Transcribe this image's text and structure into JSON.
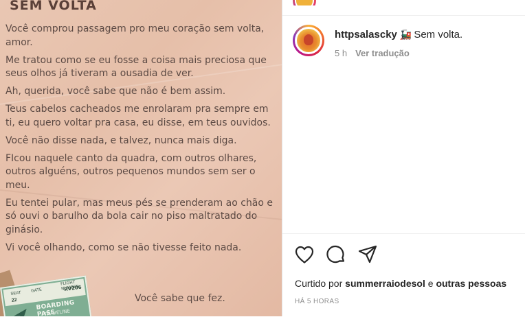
{
  "poem": {
    "title": "SEM VOLTA",
    "stanzas": [
      "Você comprou passagem pro meu coração sem volta, amor.",
      "Me tratou como se eu fosse a coisa mais preciosa que seus olhos já tiveram a ousadia de ver.",
      "Ah, querida, você sabe que não é bem assim.",
      "Teus cabelos cacheados me enrolaram pra sempre em ti, eu quero voltar pra casa, eu disse, em teus ouvidos.",
      "Você não disse nada, e talvez, nunca mais diga.",
      "FIcou naquele canto da quadra, com outros olhares, outros alguéns, outros pequenos mundos sem ser o meu.",
      "Eu tentei pular, mas meus pés se prenderam ao chão e só ouvi o barulho da bola cair no piso maltratado do ginásio.",
      "Vi você olhando, como se não tivesse feito nada."
    ],
    "signoff": "Você sabe que fez.",
    "ticket": {
      "label_top": "GATE",
      "seat": "SEAT",
      "gate": "22",
      "flight_label": "FLIGHT NUMBER",
      "flight_number": "RV206",
      "title": "BOARDING PASS",
      "subtitle": "TRAVELINE"
    }
  },
  "post": {
    "username": "httpsalascky",
    "emoji": "🚂",
    "caption_text": "Sem volta.",
    "time": "5 h",
    "translate_label": "Ver tradução",
    "likes_prefix": "Curtido por",
    "liked_by": "summerraiodesol",
    "likes_joiner": "e",
    "likes_others": "outras pessoas",
    "time_ago": "HÁ 5 HORAS"
  },
  "icons": {
    "like": "heart-icon",
    "comment": "comment-icon",
    "share": "send-icon"
  }
}
